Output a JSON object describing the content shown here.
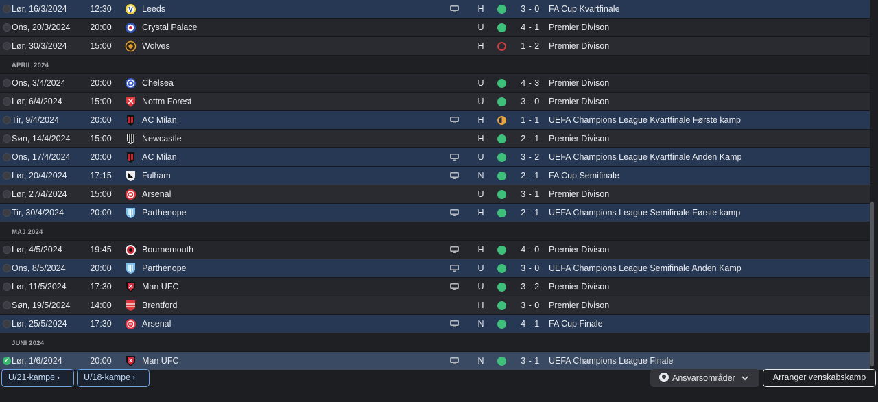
{
  "fixtures": [
    {
      "type": "match",
      "style": "hl",
      "checked": false,
      "date": "Lør, 16/3/2024",
      "time": "12:30",
      "crest": "leeds",
      "team": "Leeds",
      "tv": true,
      "venue": "H",
      "result": "win",
      "score": "3 - 0",
      "competition": "FA Cup Kvartfinale"
    },
    {
      "type": "match",
      "style": "even",
      "checked": false,
      "date": "Ons, 20/3/2024",
      "time": "20:00",
      "crest": "crystal-palace",
      "team": "Crystal Palace",
      "tv": false,
      "venue": "U",
      "result": "win",
      "score": "4 - 1",
      "competition": "Premier Divison"
    },
    {
      "type": "match",
      "style": "odd",
      "checked": false,
      "date": "Lør, 30/3/2024",
      "time": "15:00",
      "crest": "wolves",
      "team": "Wolves",
      "tv": false,
      "venue": "H",
      "result": "loss",
      "score": "1 - 2",
      "competition": "Premier Divison"
    },
    {
      "type": "month",
      "label": "APRIL 2024"
    },
    {
      "type": "match",
      "style": "even",
      "checked": false,
      "date": "Ons, 3/4/2024",
      "time": "20:00",
      "crest": "chelsea",
      "team": "Chelsea",
      "tv": false,
      "venue": "U",
      "result": "win",
      "score": "4 - 3",
      "competition": "Premier Divison"
    },
    {
      "type": "match",
      "style": "odd",
      "checked": false,
      "date": "Lør, 6/4/2024",
      "time": "15:00",
      "crest": "nottm-forest",
      "team": "Nottm Forest",
      "tv": false,
      "venue": "U",
      "result": "win",
      "score": "3 - 0",
      "competition": "Premier Divison"
    },
    {
      "type": "match",
      "style": "hl",
      "checked": false,
      "date": "Tir, 9/4/2024",
      "time": "20:00",
      "crest": "ac-milan",
      "team": "AC Milan",
      "tv": true,
      "venue": "H",
      "result": "draw",
      "score": "1 - 1",
      "competition": "UEFA Champions League Kvartfinale Første kamp"
    },
    {
      "type": "match",
      "style": "odd",
      "checked": false,
      "date": "Søn, 14/4/2024",
      "time": "15:00",
      "crest": "newcastle",
      "team": "Newcastle",
      "tv": false,
      "venue": "H",
      "result": "win",
      "score": "2 - 1",
      "competition": "Premier Divison"
    },
    {
      "type": "match",
      "style": "hl",
      "checked": false,
      "date": "Ons, 17/4/2024",
      "time": "20:00",
      "crest": "ac-milan",
      "team": "AC Milan",
      "tv": true,
      "venue": "U",
      "result": "win",
      "score": "3 - 2",
      "competition": "UEFA Champions League Kvartfinale Anden Kamp"
    },
    {
      "type": "match",
      "style": "hl",
      "checked": false,
      "date": "Lør, 20/4/2024",
      "time": "17:15",
      "crest": "fulham",
      "team": "Fulham",
      "tv": true,
      "venue": "N",
      "result": "win",
      "score": "2 - 1",
      "competition": "FA Cup Semifinale"
    },
    {
      "type": "match",
      "style": "odd",
      "checked": false,
      "date": "Lør, 27/4/2024",
      "time": "15:00",
      "crest": "arsenal",
      "team": "Arsenal",
      "tv": false,
      "venue": "U",
      "result": "win",
      "score": "3 - 1",
      "competition": "Premier Divison"
    },
    {
      "type": "match",
      "style": "hl",
      "checked": false,
      "date": "Tir, 30/4/2024",
      "time": "20:00",
      "crest": "parthenope",
      "team": "Parthenope",
      "tv": true,
      "venue": "H",
      "result": "win",
      "score": "2 - 1",
      "competition": "UEFA Champions League Semifinale Første kamp"
    },
    {
      "type": "month",
      "label": "MAJ 2024"
    },
    {
      "type": "match",
      "style": "even",
      "checked": false,
      "date": "Lør, 4/5/2024",
      "time": "19:45",
      "crest": "bournemouth",
      "team": "Bournemouth",
      "tv": true,
      "venue": "H",
      "result": "win",
      "score": "4 - 0",
      "competition": "Premier Divison"
    },
    {
      "type": "match",
      "style": "hl",
      "checked": false,
      "date": "Ons, 8/5/2024",
      "time": "20:00",
      "crest": "parthenope",
      "team": "Parthenope",
      "tv": true,
      "venue": "U",
      "result": "win",
      "score": "3 - 0",
      "competition": "UEFA Champions League Semifinale Anden Kamp"
    },
    {
      "type": "match",
      "style": "even",
      "checked": false,
      "date": "Lør, 11/5/2024",
      "time": "17:30",
      "crest": "man-ufc",
      "team": "Man UFC",
      "tv": true,
      "venue": "U",
      "result": "win",
      "score": "3 - 2",
      "competition": "Premier Divison"
    },
    {
      "type": "match",
      "style": "odd",
      "checked": false,
      "date": "Søn, 19/5/2024",
      "time": "14:00",
      "crest": "brentford",
      "team": "Brentford",
      "tv": false,
      "venue": "H",
      "result": "win",
      "score": "3 - 0",
      "competition": "Premier Divison"
    },
    {
      "type": "match",
      "style": "hl",
      "checked": false,
      "date": "Lør, 25/5/2024",
      "time": "17:30",
      "crest": "arsenal",
      "team": "Arsenal",
      "tv": true,
      "venue": "N",
      "result": "win",
      "score": "4 - 1",
      "competition": "FA Cup Finale"
    },
    {
      "type": "month",
      "label": "JUNI 2024"
    },
    {
      "type": "match",
      "style": "sel",
      "checked": true,
      "date": "Lør, 1/6/2024",
      "time": "20:00",
      "crest": "man-ufc",
      "team": "Man UFC",
      "tv": true,
      "venue": "N",
      "result": "win",
      "score": "3 - 1",
      "competition": "UEFA Champions League Finale"
    }
  ],
  "crest_colors": {
    "leeds": "#f2d53c",
    "crystal-palace": "#3557b7",
    "wolves": "#e2a033",
    "chelsea": "#3a5fcf",
    "nottm-forest": "#e0383f",
    "ac-milan": "#d0222e",
    "newcastle": "#eeeeee",
    "fulham": "#eeeeee",
    "arsenal": "#e0383f",
    "parthenope": "#7ec0ee",
    "bournemouth": "#d8283a",
    "man-ufc": "#d8283a",
    "brentford": "#e0383f"
  },
  "footer": {
    "u21_label": "U/21-kampe",
    "u18_label": "U/18-kampe",
    "responsibilities_label": "Ansvarsområder",
    "arrange_friendly_label": "Arranger venskabskamp"
  }
}
